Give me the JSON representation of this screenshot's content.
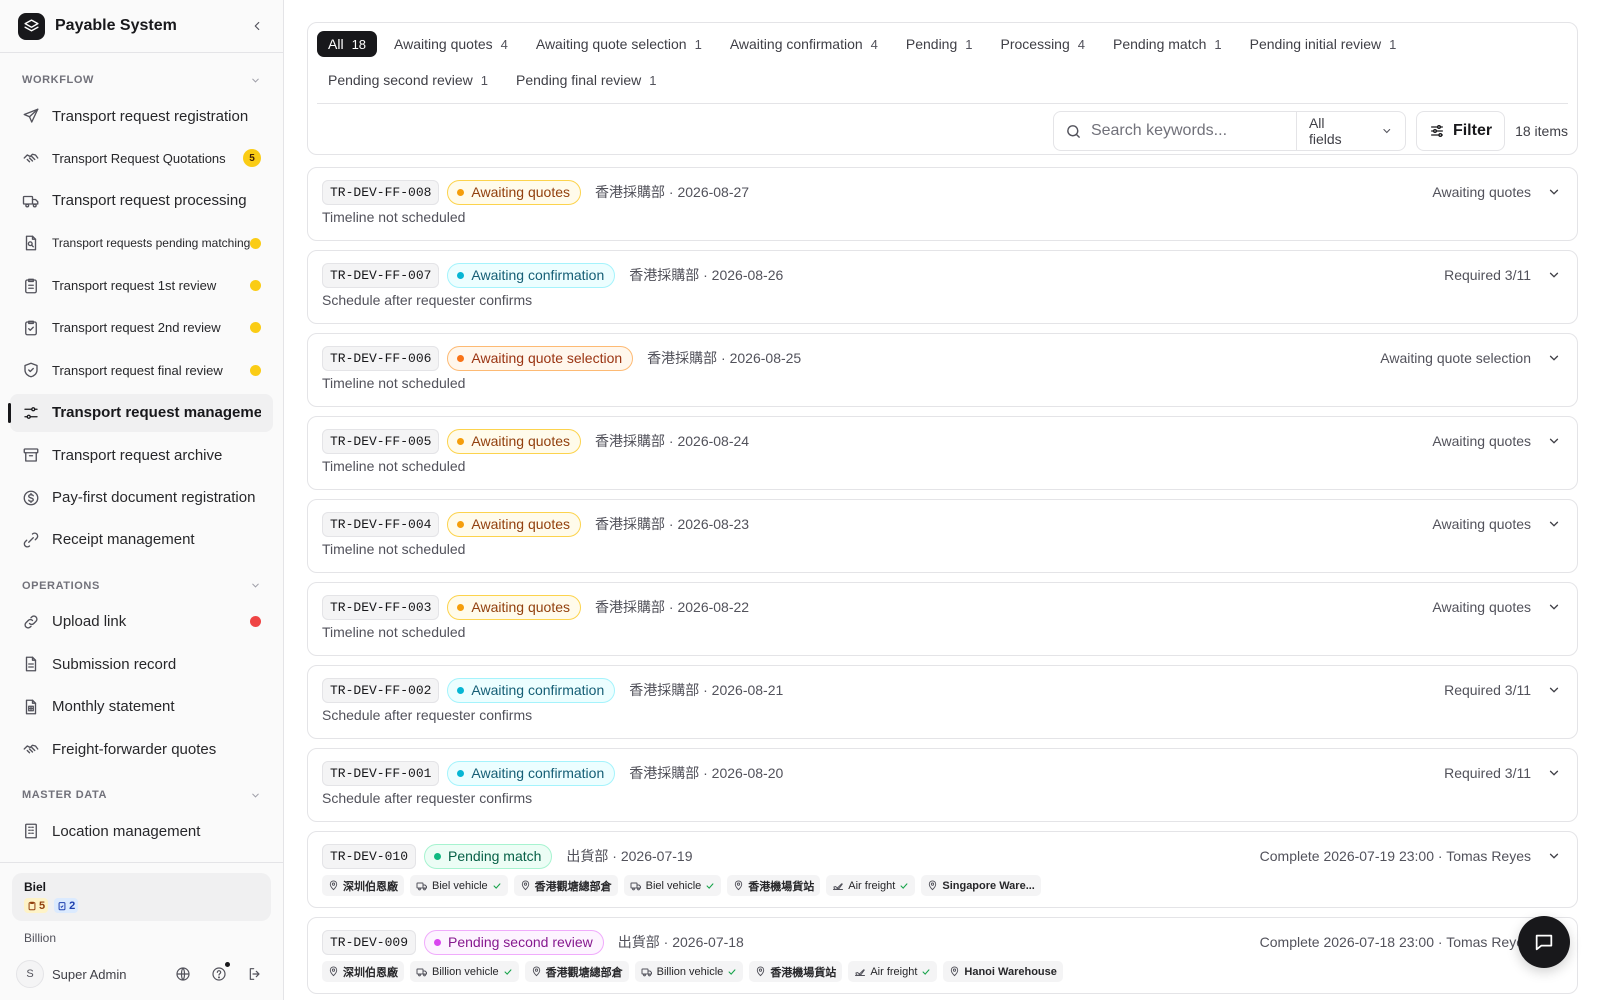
{
  "app": {
    "title": "Payable System"
  },
  "sidebar": {
    "sections": [
      {
        "title": "WORKFLOW",
        "items": [
          {
            "label": "Transport request registration",
            "icon": "send-icon",
            "size": ""
          },
          {
            "label": "Transport Request Quotations",
            "icon": "handshake-icon",
            "size": "sm",
            "badge": "5"
          },
          {
            "label": "Transport request processing",
            "icon": "truck-icon",
            "size": ""
          },
          {
            "label": "Transport requests pending matching",
            "icon": "file-search-icon",
            "size": "xs",
            "dot": "yellow"
          },
          {
            "label": "Transport request 1st review",
            "icon": "clipboard-list-icon",
            "size": "sm",
            "dot": "yellow"
          },
          {
            "label": "Transport request 2nd review",
            "icon": "clipboard-check-icon",
            "size": "sm",
            "dot": "yellow"
          },
          {
            "label": "Transport request final review",
            "icon": "shield-check-icon",
            "size": "sm",
            "dot": "yellow"
          },
          {
            "label": "Transport request management",
            "icon": "sliders-icon",
            "size": "",
            "active": true
          },
          {
            "label": "Transport request archive",
            "icon": "archive-icon",
            "size": ""
          },
          {
            "label": "Pay-first document registration",
            "icon": "dollar-circle-icon",
            "size": ""
          },
          {
            "label": "Receipt management",
            "icon": "receipt-icon",
            "size": ""
          }
        ]
      },
      {
        "title": "OPERATIONS",
        "items": [
          {
            "label": "Upload link",
            "icon": "link-icon",
            "size": "",
            "dot": "red"
          },
          {
            "label": "Submission record",
            "icon": "file-text-icon",
            "size": ""
          },
          {
            "label": "Monthly statement",
            "icon": "file-spreadsheet-icon",
            "size": ""
          },
          {
            "label": "Freight-forwarder quotes",
            "icon": "handshake-icon",
            "size": ""
          }
        ]
      },
      {
        "title": "MASTER DATA",
        "items": [
          {
            "label": "Location management",
            "icon": "building-icon",
            "size": ""
          }
        ]
      }
    ],
    "org": {
      "name": "Biel",
      "badge_yellow": "5",
      "badge_blue": "2",
      "alt": "Billion"
    },
    "user": {
      "initial": "S",
      "name": "Super Admin"
    }
  },
  "tabs": [
    {
      "label": "All",
      "count": "18",
      "active": true
    },
    {
      "label": "Awaiting quotes",
      "count": "4"
    },
    {
      "label": "Awaiting quote selection",
      "count": "1"
    },
    {
      "label": "Awaiting confirmation",
      "count": "4"
    },
    {
      "label": "Pending",
      "count": "1"
    },
    {
      "label": "Processing",
      "count": "4"
    },
    {
      "label": "Pending match",
      "count": "1"
    },
    {
      "label": "Pending initial review",
      "count": "1"
    },
    {
      "label": "Pending second review",
      "count": "1"
    },
    {
      "label": "Pending final review",
      "count": "1"
    }
  ],
  "toolbar": {
    "search_placeholder": "Search keywords...",
    "field_select": "All fields",
    "filter_label": "Filter",
    "items_count": "18 items"
  },
  "requests": [
    {
      "code": "TR-DEV-FF-008",
      "status": "Awaiting quotes",
      "status_kind": "quotes",
      "meta": "香港採購部 · 2026-08-27",
      "right": "Awaiting quotes",
      "sub": "Timeline not scheduled"
    },
    {
      "code": "TR-DEV-FF-007",
      "status": "Awaiting confirmation",
      "status_kind": "confirm",
      "meta": "香港採購部 · 2026-08-26",
      "right": "Required 3/11",
      "sub": "Schedule after requester confirms"
    },
    {
      "code": "TR-DEV-FF-006",
      "status": "Awaiting quote selection",
      "status_kind": "select",
      "meta": "香港採購部 · 2026-08-25",
      "right": "Awaiting quote selection",
      "sub": "Timeline not scheduled"
    },
    {
      "code": "TR-DEV-FF-005",
      "status": "Awaiting quotes",
      "status_kind": "quotes",
      "meta": "香港採購部 · 2026-08-24",
      "right": "Awaiting quotes",
      "sub": "Timeline not scheduled"
    },
    {
      "code": "TR-DEV-FF-004",
      "status": "Awaiting quotes",
      "status_kind": "quotes",
      "meta": "香港採購部 · 2026-08-23",
      "right": "Awaiting quotes",
      "sub": "Timeline not scheduled"
    },
    {
      "code": "TR-DEV-FF-003",
      "status": "Awaiting quotes",
      "status_kind": "quotes",
      "meta": "香港採購部 · 2026-08-22",
      "right": "Awaiting quotes",
      "sub": "Timeline not scheduled"
    },
    {
      "code": "TR-DEV-FF-002",
      "status": "Awaiting confirmation",
      "status_kind": "confirm",
      "meta": "香港採購部 · 2026-08-21",
      "right": "Required 3/11",
      "sub": "Schedule after requester confirms"
    },
    {
      "code": "TR-DEV-FF-001",
      "status": "Awaiting confirmation",
      "status_kind": "confirm",
      "meta": "香港採購部 · 2026-08-20",
      "right": "Required 3/11",
      "sub": "Schedule after requester confirms"
    },
    {
      "code": "TR-DEV-010",
      "status": "Pending match",
      "status_kind": "match",
      "meta": "出貨部 · 2026-07-19",
      "right": "Complete 2026-07-19 23:00 · Tomas Reyes",
      "route": [
        {
          "kind": "loc",
          "text": "深圳伯恩廠"
        },
        {
          "kind": "vehicle",
          "text": "Biel vehicle"
        },
        {
          "kind": "loc",
          "text": "香港觀塘總部倉"
        },
        {
          "kind": "vehicle",
          "text": "Biel vehicle"
        },
        {
          "kind": "loc",
          "text": "香港機場貨站"
        },
        {
          "kind": "air",
          "text": "Air freight"
        },
        {
          "kind": "loc",
          "text": "Singapore Ware..."
        }
      ]
    },
    {
      "code": "TR-DEV-009",
      "status": "Pending second review",
      "status_kind": "second",
      "meta": "出貨部 · 2026-07-18",
      "right": "Complete 2026-07-18 23:00 · Tomas Reyes",
      "route": [
        {
          "kind": "loc",
          "text": "深圳伯恩廠"
        },
        {
          "kind": "vehicle",
          "text": "Billion vehicle"
        },
        {
          "kind": "loc",
          "text": "香港觀塘總部倉"
        },
        {
          "kind": "vehicle",
          "text": "Billion vehicle"
        },
        {
          "kind": "loc",
          "text": "香港機場貨站"
        },
        {
          "kind": "air",
          "text": "Air freight"
        },
        {
          "kind": "loc",
          "text": "Hanoi Warehouse"
        }
      ]
    }
  ],
  "colors": {
    "accent": "#18181b",
    "dot_yellow": "#facc15",
    "dot_red": "#ef4444"
  }
}
